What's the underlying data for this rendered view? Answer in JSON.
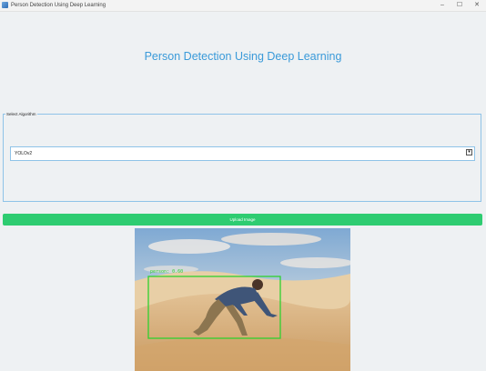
{
  "window": {
    "title": "Person Detection Using Deep Learning",
    "controls": {
      "minimize": "–",
      "maximize": "☐",
      "close": "✕"
    }
  },
  "heading": "Person Detection Using Deep Learning",
  "algorithm": {
    "legend": "Select Algorithm",
    "selected": "YOLOv2",
    "arrow": "▾"
  },
  "upload_button": "Upload Image",
  "preview": {
    "detection_label": "person: 0.60",
    "colors": {
      "box": "#2fd12f",
      "sand": "#d8b27f",
      "sky": "#8fb4d8"
    }
  },
  "colors": {
    "accent": "#3a9ad9",
    "button": "#2ecc71",
    "border": "#8fc3e8",
    "background": "#eef1f3"
  }
}
